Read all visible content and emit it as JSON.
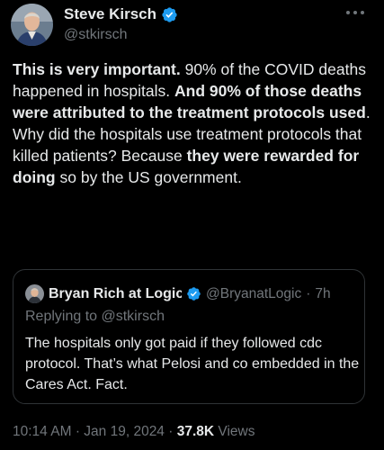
{
  "author": {
    "display_name": "Steve Kirsch",
    "handle": "@stkirsch"
  },
  "tweet": {
    "segments": [
      {
        "text": "This is very important.",
        "bold": true
      },
      {
        "text": " 90% of the COVID deaths happened in hospitals. ",
        "bold": false
      },
      {
        "text": "And 90% of those deaths were attributed to the treatment protocols used",
        "bold": true
      },
      {
        "text": ". Why did the hospitals use treatment protocols that killed patients? Because ",
        "bold": false
      },
      {
        "text": "they were rewarded for doing",
        "bold": true
      },
      {
        "text": " so by the US government.",
        "bold": false
      }
    ]
  },
  "quote": {
    "display_name": "Bryan Rich at Logic",
    "handle": "@BryanatLogic",
    "separator": "·",
    "time": "7h",
    "replying_to": "Replying to @stkirsch",
    "text": "The hospitals only got paid if they followed cdc protocol.  That’s what Pelosi and co embedded in the Cares Act.  Fact."
  },
  "meta": {
    "time": "10:14 AM",
    "separator": "·",
    "date": "Jan 19, 2024",
    "views_count": "37.8K",
    "views_label": "Views"
  },
  "colors": {
    "background": "#000000",
    "text": "#e7e9ea",
    "secondary_text": "#71767b",
    "verified_blue": "#1d9bf0",
    "border": "#2f3336"
  },
  "icons": {
    "verified": "verified-badge-icon",
    "more": "more-options-icon"
  }
}
